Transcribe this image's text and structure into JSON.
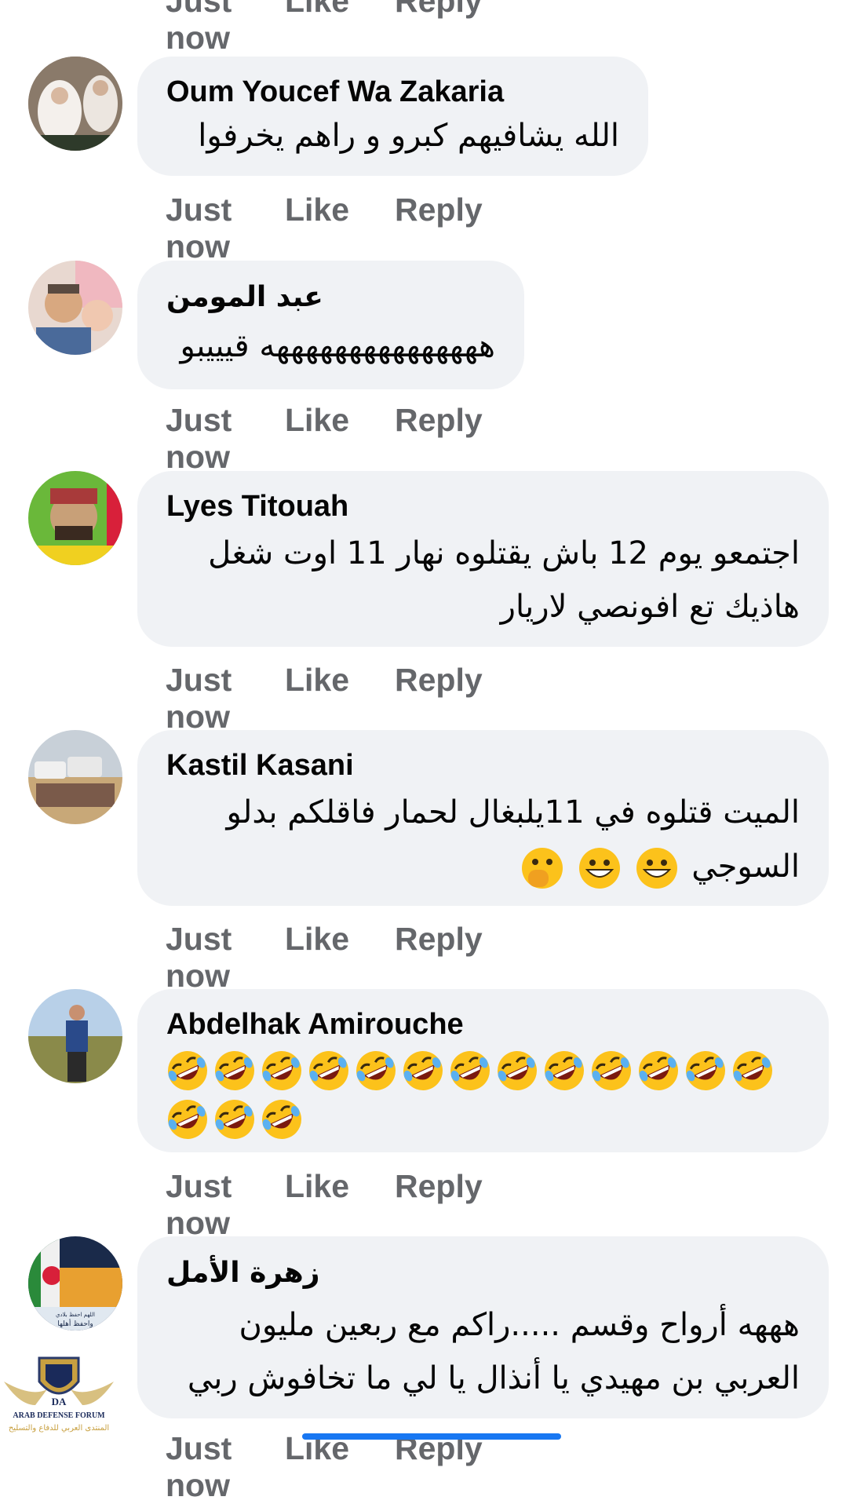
{
  "actions": {
    "time": "Just now",
    "like": "Like",
    "reply": "Reply"
  },
  "comments": [
    {
      "name": "Oum Youcef Wa Zakaria",
      "lines": [
        "الله يشافيهم كبرو  و راهم يخرفوا"
      ]
    },
    {
      "name": "عبد المومن",
      "lines": [
        "هههههههههههههههه قيييبو"
      ]
    },
    {
      "name": "Lyes Titouah",
      "lines": [
        "اجتمعو يوم 12 باش يقتلوه نهار 11 اوت شغل",
        "هاذيك تع افونصي لاريار"
      ]
    },
    {
      "name": "Kastil Kasani",
      "lines": [
        "الميت قتلوه في 11يلبغال لحمار فاقلكم بدلو",
        "السوجي"
      ],
      "emojis": [
        "grinning-face",
        "grinning-face",
        "hand-over-mouth-face"
      ]
    },
    {
      "name": "Abdelhak Amirouche",
      "emoji_rows": [
        13,
        3
      ],
      "emoji": "rolling-on-floor-laughing"
    },
    {
      "name": "زهرة الأمل",
      "lines": [
        "هههه أرواح وقسم .....راكم مع ربعين مليون",
        "العربي بن مهيدي يا أنذال يا لي ما تخافوش ربي"
      ]
    }
  ],
  "watermark": {
    "line1": "ARAB DEFENSE FORUM",
    "line2": "المنتدى العربي للدفاع والتسليح",
    "monogram": "DA"
  },
  "avatar_flag_text": {
    "line1": "اللهم احفظ بلادي",
    "line2": "واحفظ أهلها"
  },
  "colors": {
    "bubble": "#f0f2f5",
    "action_text": "#65676b",
    "name_text": "#050505"
  }
}
